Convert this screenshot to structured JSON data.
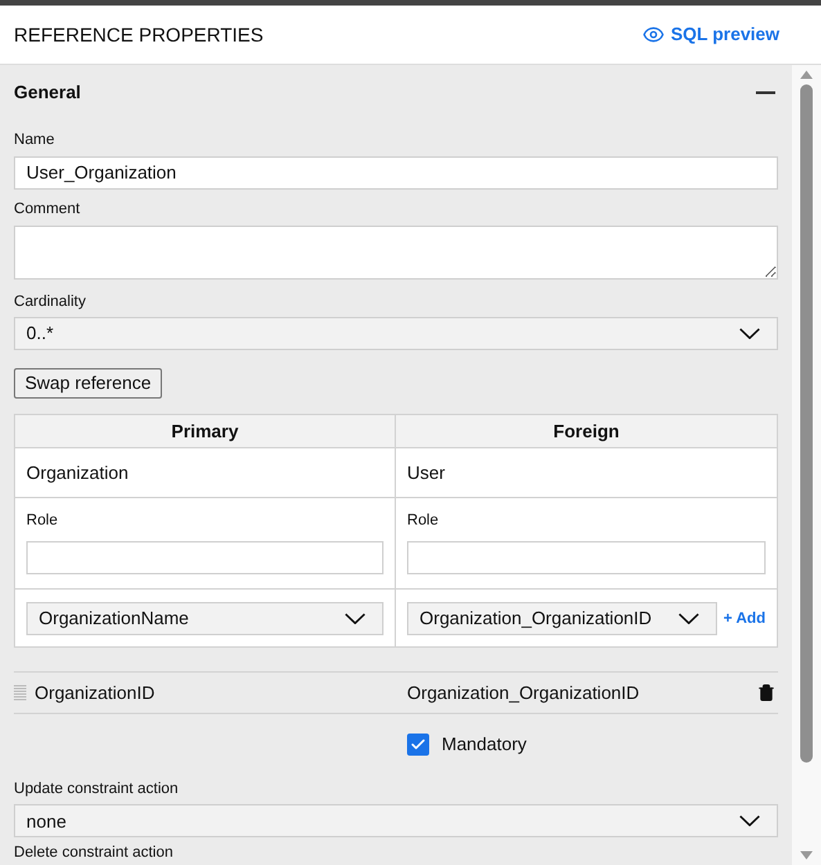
{
  "header": {
    "title": "REFERENCE PROPERTIES",
    "preview_link": "SQL preview"
  },
  "section": {
    "title": "General",
    "expanded": true
  },
  "name_field": {
    "label": "Name",
    "value": "User_Organization"
  },
  "comment_field": {
    "label": "Comment"
  },
  "cardinality": {
    "label": "Cardinality",
    "value": "0..*"
  },
  "swap_button": "Swap reference",
  "columns": {
    "primary": {
      "heading": "Primary",
      "table": "Organization",
      "role_label": "Role",
      "column_select": "OrganizationName"
    },
    "foreign": {
      "heading": "Foreign",
      "table": "User",
      "role_label": "Role",
      "column_select": "Organization_OrganizationID",
      "add_link": "+ Add"
    }
  },
  "pairs": [
    {
      "primary": "OrganizationID",
      "foreign": "Organization_OrganizationID"
    }
  ],
  "mandatory": {
    "label": "Mandatory",
    "checked": true
  },
  "update_action": {
    "label": "Update constraint action",
    "value": "none"
  },
  "delete_action": {
    "label": "Delete constraint action"
  }
}
